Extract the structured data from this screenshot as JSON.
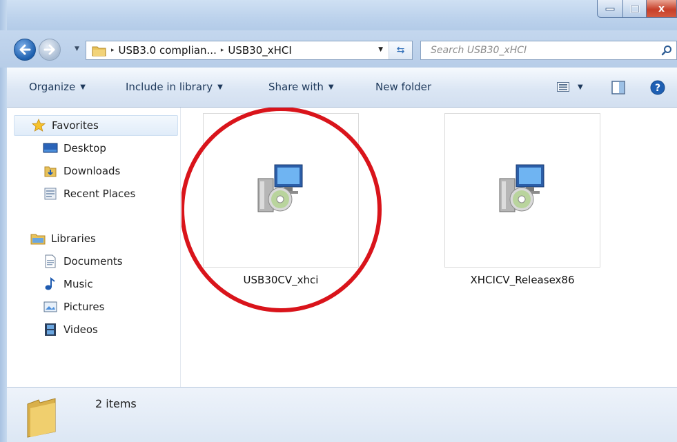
{
  "window": {
    "controls": {
      "minimize_icon": "minimize-icon",
      "maximize_icon": "maximize-icon",
      "close_icon": "close-icon",
      "close_glyph": "x"
    }
  },
  "address_bar": {
    "breadcrumbs": [
      "USB3.0 complian...",
      "USB30_xHCI"
    ],
    "separator": "▸",
    "dropdown_glyph": "▼",
    "refresh_glyph": "⇆"
  },
  "search": {
    "placeholder": "Search USB30_xHCI"
  },
  "toolbar": {
    "organize": "Organize",
    "include_in_library": "Include in library",
    "share_with": "Share with",
    "new_folder": "New folder",
    "dropdown_glyph": "▼",
    "help_glyph": "?"
  },
  "nav_pane": {
    "favorites": {
      "label": "Favorites",
      "items": [
        "Desktop",
        "Downloads",
        "Recent Places"
      ]
    },
    "libraries": {
      "label": "Libraries",
      "items": [
        "Documents",
        "Music",
        "Pictures",
        "Videos"
      ]
    }
  },
  "files": [
    {
      "name": "USB30CV_xhci",
      "icon": "setup-installer-icon"
    },
    {
      "name": "XHCICV_Releasex86",
      "icon": "setup-installer-icon"
    }
  ],
  "annotation": {
    "color": "#d9141b",
    "shape": "circle"
  },
  "status": {
    "items_count": "2 items"
  },
  "colors": {
    "accent": "#1e395b",
    "window_chrome": "#bcd2ec",
    "highlight_red": "#d9141b"
  }
}
